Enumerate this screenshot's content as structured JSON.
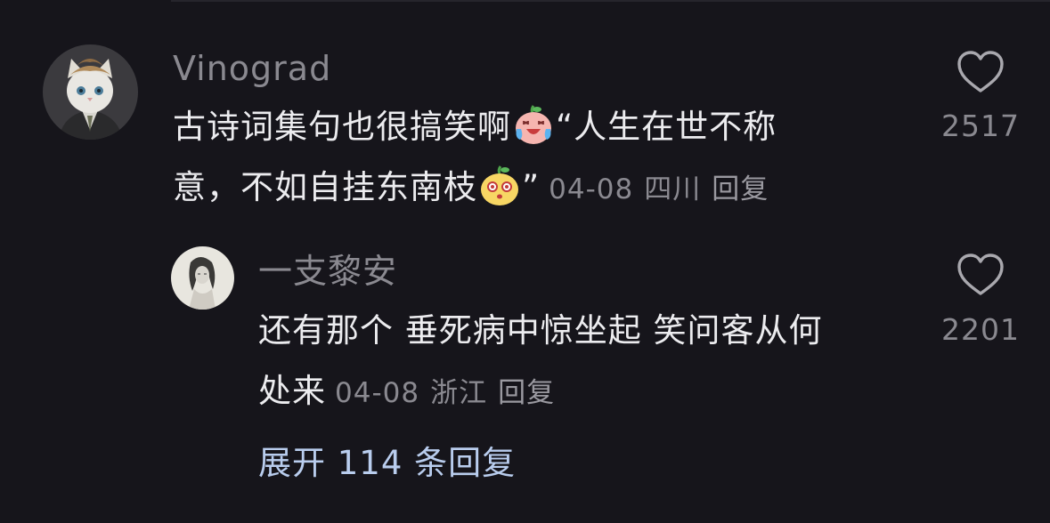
{
  "comment": {
    "username": "Vinograd",
    "text_line1": "古诗词集句也很搞笑啊",
    "quote_part1": "“人生在世不称",
    "text_line2": "意，不如自挂东南枝",
    "quote_close": "”",
    "date": "04-08",
    "location": "四川",
    "reply_label": "回复",
    "like_count": "2517",
    "avatar_icon": "cat-avatar",
    "emoji1": "crying-laughing-peach-emoji",
    "emoji2": "dizzy-pear-emoji"
  },
  "reply": {
    "username": "一支黎安",
    "text_line1": "还有那个 垂死病中惊坐起  笑问客从何",
    "text_line2": "处来",
    "date": "04-08",
    "location": "浙江",
    "reply_label": "回复",
    "like_count": "2201",
    "avatar_icon": "sketch-girl-avatar"
  },
  "expand_replies": "展开 114 条回复",
  "colors": {
    "background": "#16151b",
    "text": "#ececef",
    "muted": "#8a8990",
    "link": "#b9cdee"
  }
}
